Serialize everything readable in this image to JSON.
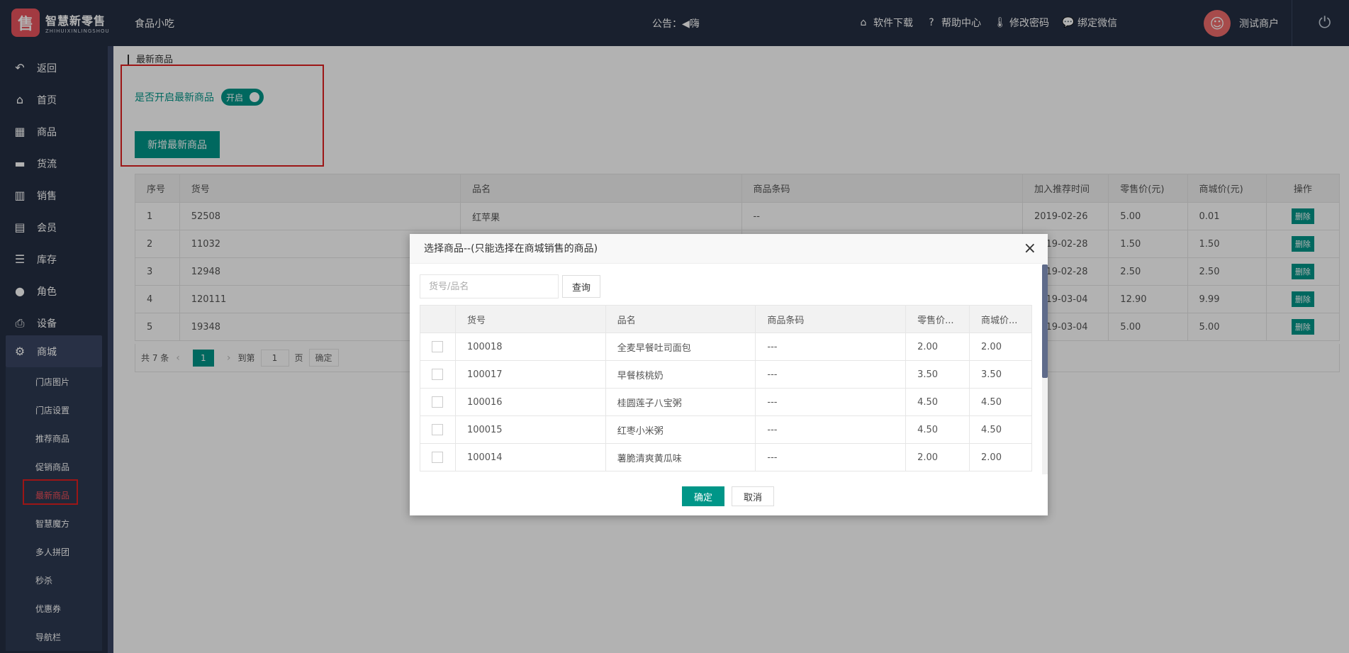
{
  "header": {
    "logo_title": "智慧新零售",
    "logo_sub": "ZHIHUIXINLINGSHOU",
    "shop_name": "食品小吃",
    "notice_label": "公告：",
    "notice_text": "嗨",
    "links": [
      {
        "label": "软件下载",
        "icon": "store-icon"
      },
      {
        "label": "帮助中心",
        "icon": "question-circle-icon"
      },
      {
        "label": "修改密码",
        "icon": "thermometer-icon"
      },
      {
        "label": "绑定微信",
        "icon": "chat-bubbles-icon"
      }
    ],
    "user_name": "测试商户"
  },
  "sidebar": {
    "items": [
      {
        "label": "返回",
        "icon": "back-arrow-icon"
      },
      {
        "label": "首页",
        "icon": "home-icon"
      },
      {
        "label": "商品",
        "icon": "grid-icon"
      },
      {
        "label": "货流",
        "icon": "truck-icon"
      },
      {
        "label": "销售",
        "icon": "bar-chart-icon"
      },
      {
        "label": "会员",
        "icon": "id-card-icon"
      },
      {
        "label": "库存",
        "icon": "database-icon"
      },
      {
        "label": "角色",
        "icon": "user-icon"
      },
      {
        "label": "设备",
        "icon": "printer-icon"
      },
      {
        "label": "商城",
        "icon": "gear-icon"
      }
    ],
    "submenu": [
      "门店图片",
      "门店设置",
      "推荐商品",
      "促销商品",
      "最新商品",
      "智慧魔方",
      "多人拼团",
      "秒杀",
      "优惠券",
      "导航栏"
    ],
    "current_submenu": "最新商品"
  },
  "content": {
    "breadcrumb": "最新商品",
    "toggle_label": "是否开启最新商品",
    "toggle_text": "开启",
    "add_button": "新增最新商品",
    "table": {
      "headers": [
        "序号",
        "货号",
        "品名",
        "商品条码",
        "加入推荐时间",
        "零售价(元)",
        "商城价(元)",
        "操作"
      ],
      "rows": [
        [
          "1",
          "52508",
          "红苹果",
          "--",
          "2019-02-26",
          "5.00",
          "0.01"
        ],
        [
          "2",
          "11032",
          "",
          "",
          "2019-02-28",
          "1.50",
          "1.50"
        ],
        [
          "3",
          "12948",
          "",
          "",
          "2019-02-28",
          "2.50",
          "2.50"
        ],
        [
          "4",
          "120111",
          "",
          "",
          "2019-03-04",
          "12.90",
          "9.99"
        ],
        [
          "5",
          "19348",
          "",
          "",
          "2019-03-04",
          "5.00",
          "5.00"
        ]
      ],
      "delete_label": "删除"
    },
    "pager": {
      "total": "共 7 条",
      "current_page": "1",
      "goto_label": "到第",
      "goto_value": "1",
      "page_unit": "页",
      "confirm": "确定"
    }
  },
  "modal": {
    "title": "选择商品--(只能选择在商城销售的商品)",
    "search_placeholder": "货号/品名",
    "query_button": "查询",
    "headers": [
      "货号",
      "品名",
      "商品条码",
      "零售价...",
      "商城价..."
    ],
    "rows": [
      [
        "100018",
        "全麦早餐吐司面包",
        "---",
        "2.00",
        "2.00"
      ],
      [
        "100017",
        "早餐核桃奶",
        "---",
        "3.50",
        "3.50"
      ],
      [
        "100016",
        "桂圆莲子八宝粥",
        "---",
        "4.50",
        "4.50"
      ],
      [
        "100015",
        "红枣小米粥",
        "---",
        "4.50",
        "4.50"
      ],
      [
        "100014",
        "薯脆清爽黄瓜味",
        "---",
        "2.00",
        "2.00"
      ]
    ],
    "ok_button": "确定",
    "cancel_button": "取消"
  },
  "colors": {
    "header_bg": "#242f42",
    "accent": "#009688",
    "highlight_red": "#e02020"
  }
}
